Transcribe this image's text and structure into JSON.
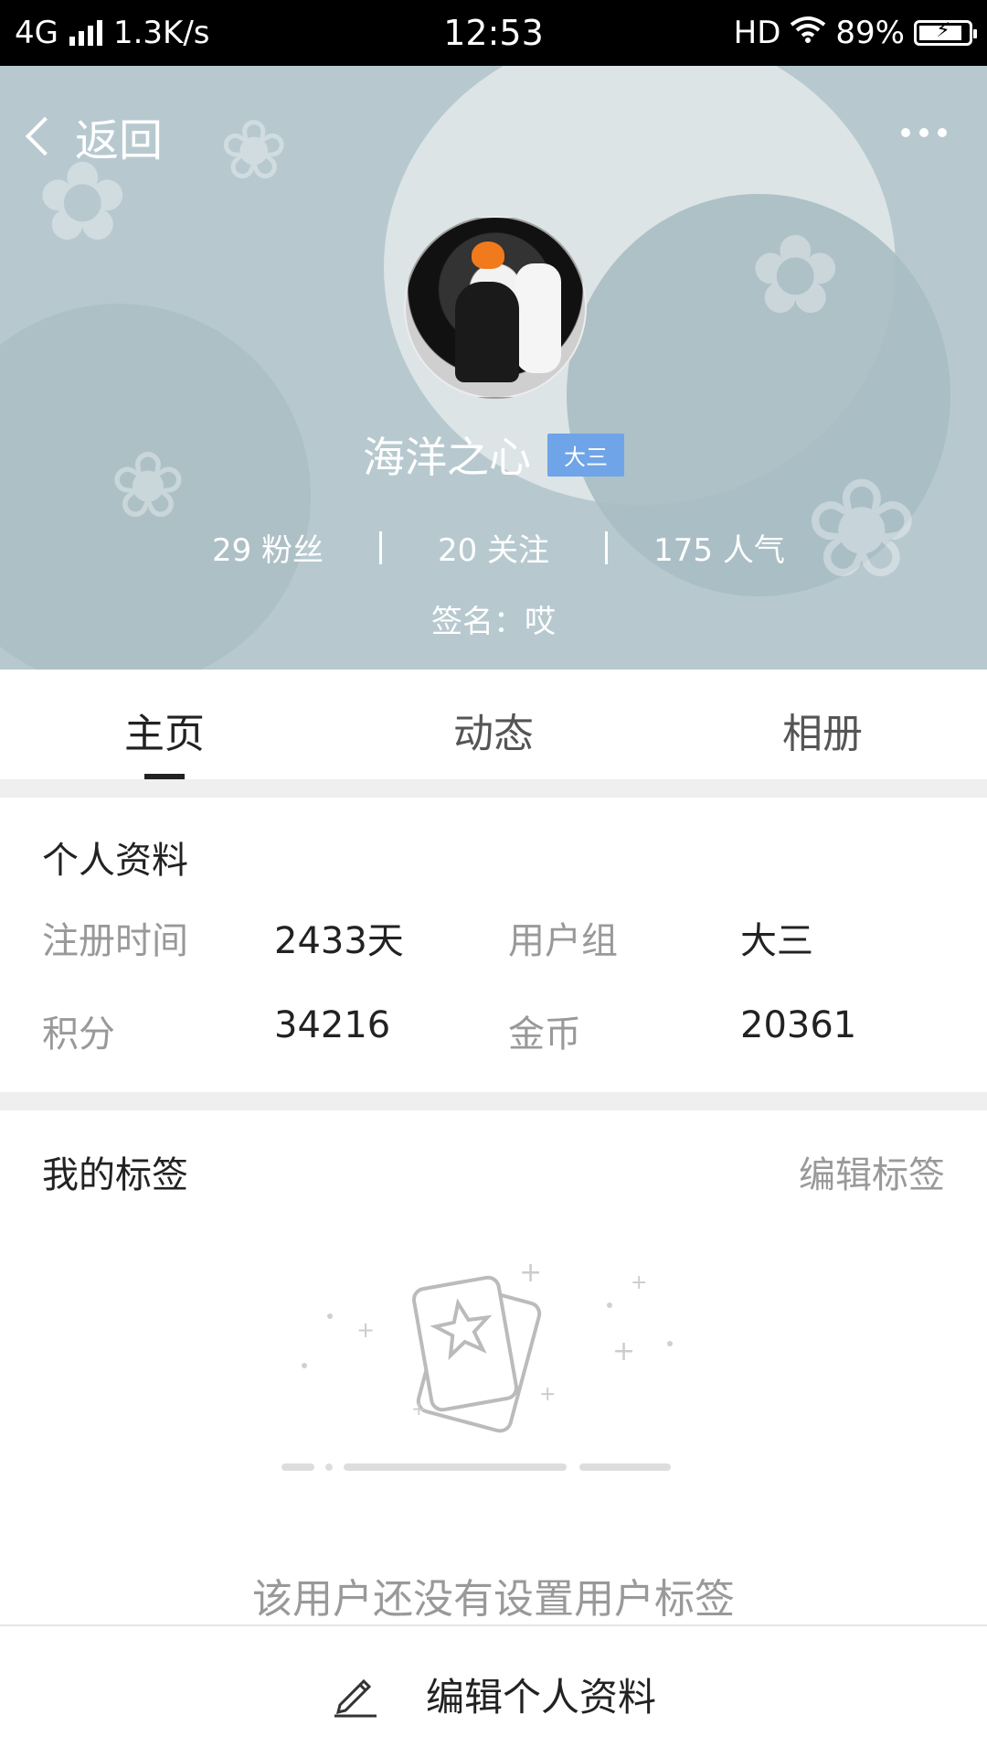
{
  "status_bar": {
    "network": "4G",
    "speed": "1.3K/s",
    "time": "12:53",
    "hd": "HD",
    "battery_percent": "89%",
    "battery_level": 0.89
  },
  "header": {
    "back_label": "返回",
    "username": "海洋之心",
    "level_badge": "大三",
    "stats": [
      {
        "value": "29",
        "label": "粉丝"
      },
      {
        "value": "20",
        "label": "关注"
      },
      {
        "value": "175",
        "label": "人气"
      }
    ],
    "signature": "签名：哎"
  },
  "tabs": [
    {
      "label": "主页",
      "active": true
    },
    {
      "label": "动态",
      "active": false
    },
    {
      "label": "相册",
      "active": false
    }
  ],
  "profile": {
    "title": "个人资料",
    "fields": [
      {
        "key": "注册时间",
        "value": "2433天"
      },
      {
        "key": "用户组",
        "value": "大三"
      },
      {
        "key": "积分",
        "value": "34216"
      },
      {
        "key": "金币",
        "value": "20361"
      }
    ]
  },
  "tags": {
    "title": "我的标签",
    "edit_label": "编辑标签",
    "empty_message": "该用户还没有设置用户标签"
  },
  "bottom_bar": {
    "edit_profile_label": "编辑个人资料",
    "icon": "pencil-icon"
  },
  "colors": {
    "banner": "#b7c9cf",
    "badge": "#6fa4e8",
    "muted_text": "#999999"
  }
}
